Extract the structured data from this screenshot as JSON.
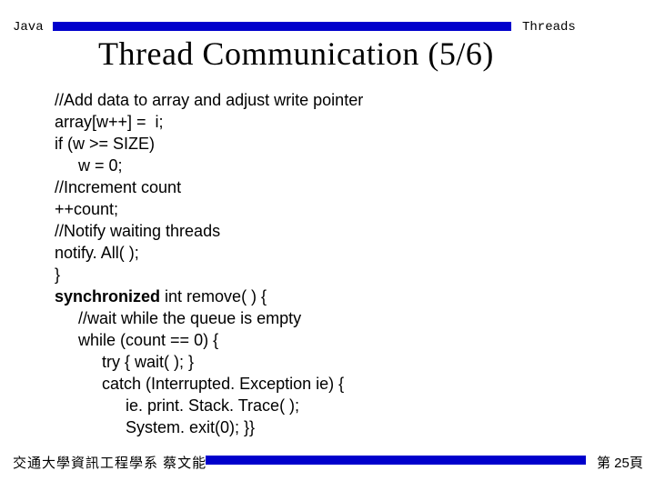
{
  "header": {
    "left": "Java",
    "right": "Threads"
  },
  "title": "Thread Communication (5/6)",
  "code": {
    "l1": "//Add data to array and adjust write pointer",
    "l2": "array[w++] =  i;",
    "l3": "if (w >= SIZE)",
    "l4": "w = 0;",
    "l5": "//Increment count",
    "l6": "++count;",
    "l7": "//Notify waiting threads",
    "l8": "notify. All( );",
    "l9": "}",
    "kw10": "synchronized",
    "rest10": " int remove( ) {",
    "l11": "//wait while the queue is empty",
    "l12": "while (count == 0) {",
    "l13": "try { wait( ); }",
    "l14": "catch (Interrupted. Exception ie) {",
    "l15": "ie. print. Stack. Trace( );",
    "l16": "System. exit(0); }}"
  },
  "footer": {
    "left": "交通大學資訊工程學系  蔡文能",
    "right": "第 25頁"
  }
}
